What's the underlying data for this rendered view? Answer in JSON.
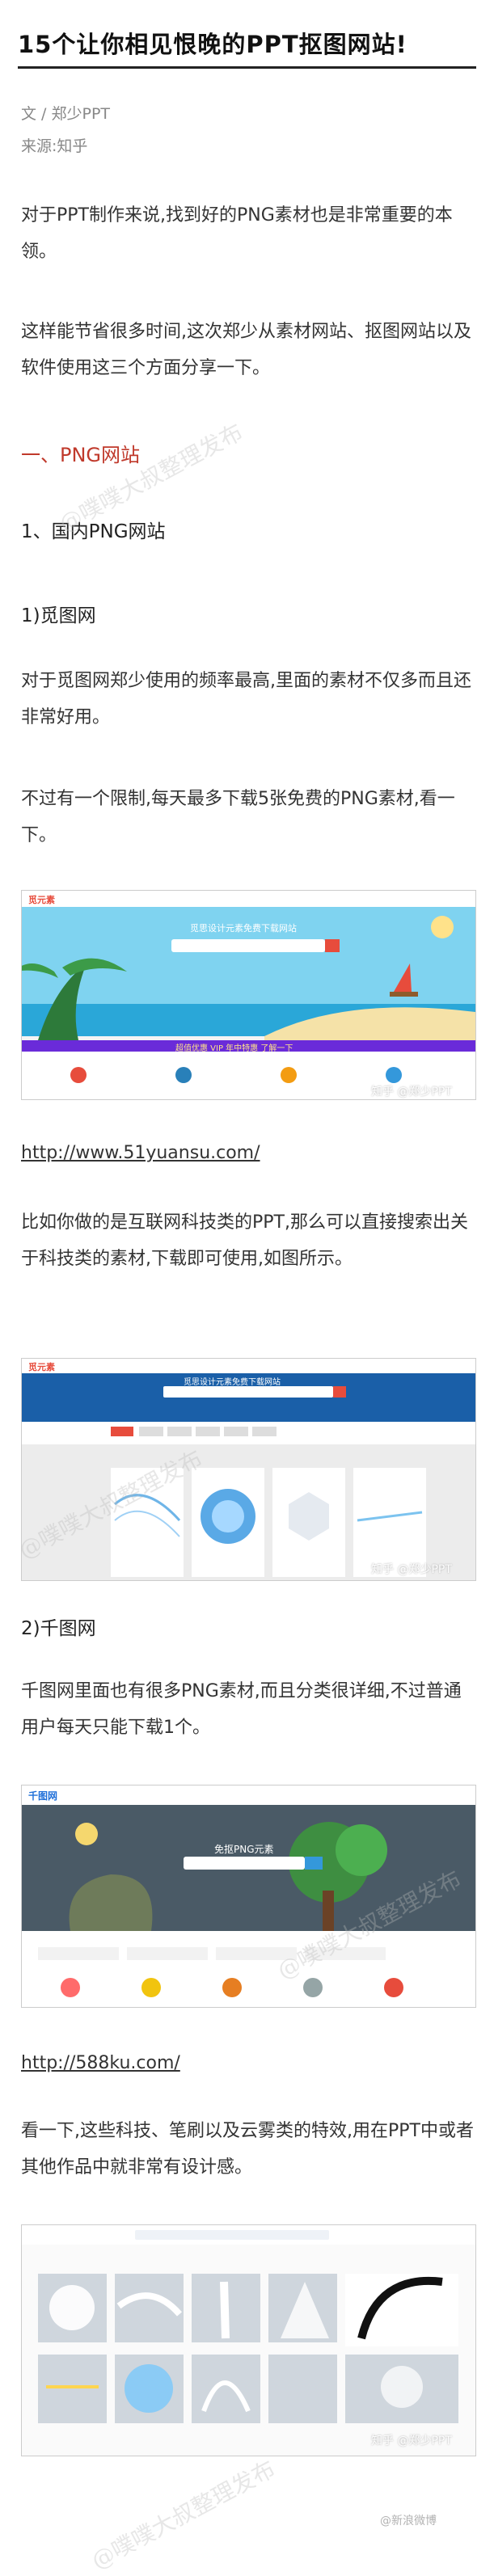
{
  "article": {
    "title": "15个让你相见恨晚的PPT抠图网站!",
    "author": "文 / 郑少PPT",
    "source": "来源:知乎",
    "p1": "对于PPT制作来说,找到好的PNG素材也是非常重要的本领。",
    "p2": "这样能节省很多时间,这次郑少从素材网站、抠图网站以及软件使用这三个方面分享一下。",
    "section1": "一、PNG网站",
    "sub1": "1、国内PNG网站",
    "item1": "1)觅图网",
    "p3": "对于觅图网郑少使用的频率最高,里面的素材不仅多而且还非常好用。",
    "p4": "不过有一个限制,每天最多下载5张免费的PNG素材,看一下。",
    "link1": "http://www.51yuansu.com/",
    "p5": "比如你做的是互联网科技类的PPT,那么可以直接搜索出关于科技类的素材,下载即可使用,如图所示。",
    "item2": "2)千图网",
    "p6": "千图网里面也有很多PNG素材,而且分类很详细,不过普通用户每天只能下载1个。",
    "link2": "http://588ku.com/",
    "p7": "看一下,这些科技、笔刷以及云雾类的特效,用在PPT中或者其他作品中就非常有设计感。"
  },
  "shots": {
    "s1": {
      "site": "觅元素",
      "search": "觅思设计元素免费下载网站",
      "banner": "超值优惠 VIP 年中特惠 了解一下",
      "watermark": "知乎 @郑少PPT"
    },
    "s2": {
      "site": "觅元素",
      "search": "觅思设计元素免费下载网站",
      "watermark": "知乎 @郑少PPT"
    },
    "s3": {
      "site": "千图网",
      "search": "免抠PNG元素",
      "watermark": ""
    },
    "s4": {
      "watermark": "知乎 @郑少PPT",
      "watermark2": "@新浪微博"
    }
  },
  "stamps": {
    "text": "@噗噗大叔整理发布"
  },
  "colors": {
    "accent_red": "#c0392b",
    "text": "#333333",
    "meta": "#888888"
  }
}
